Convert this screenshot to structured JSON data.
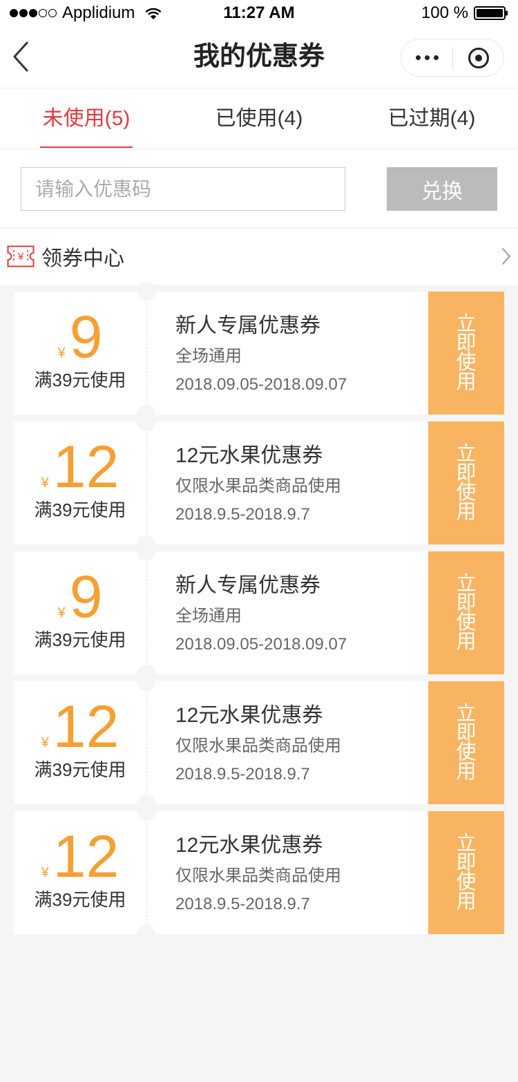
{
  "status_bar": {
    "signal": {
      "filled": 3,
      "total": 5
    },
    "carrier": "Applidium",
    "time": "11:27 AM",
    "battery_text": "100 %",
    "battery_level": 100,
    "icons": [
      "signal-strength-icon",
      "wifi-icon",
      "battery-icon"
    ]
  },
  "nav": {
    "title": "我的优惠券",
    "back_icon": "chevron-left-icon",
    "more_icon": "more-dots-icon",
    "close_icon": "target-circle-icon"
  },
  "tabs": [
    {
      "label": "未使用(5)",
      "active": true
    },
    {
      "label": "已使用(4)",
      "active": false
    },
    {
      "label": "已过期(4)",
      "active": false
    }
  ],
  "redeem": {
    "placeholder": "请输入优惠码",
    "value": "",
    "button_label": "兑换"
  },
  "coupon_center": {
    "icon": "coupon-ticket-icon",
    "icon_glyph": "¥",
    "label": "领券中心",
    "chevron_icon": "chevron-right-icon"
  },
  "coupons": [
    {
      "currency": "¥",
      "amount": "9",
      "condition": "满39元使用",
      "title": "新人专属优惠券",
      "scope": "全场通用",
      "validity": "2018.09.05-2018.09.07",
      "action": "立即使用"
    },
    {
      "currency": "¥",
      "amount": "12",
      "condition": "满39元使用",
      "title": "12元水果优惠券",
      "scope": "仅限水果品类商品使用",
      "validity": "2018.9.5-2018.9.7",
      "action": "立即使用"
    },
    {
      "currency": "¥",
      "amount": "9",
      "condition": "满39元使用",
      "title": "新人专属优惠券",
      "scope": "全场通用",
      "validity": "2018.09.05-2018.09.07",
      "action": "立即使用"
    },
    {
      "currency": "¥",
      "amount": "12",
      "condition": "满39元使用",
      "title": "12元水果优惠券",
      "scope": "仅限水果品类商品使用",
      "validity": "2018.9.5-2018.9.7",
      "action": "立即使用"
    },
    {
      "currency": "¥",
      "amount": "12",
      "condition": "满39元使用",
      "title": "12元水果优惠券",
      "scope": "仅限水果品类商品使用",
      "validity": "2018.9.5-2018.9.7",
      "action": "立即使用"
    }
  ],
  "colors": {
    "accent": "#E4393C",
    "amount": "#F5A033",
    "action": "#F9B462",
    "button_disabled": "#BBBBBB",
    "page_background": "#F5F5F5"
  }
}
